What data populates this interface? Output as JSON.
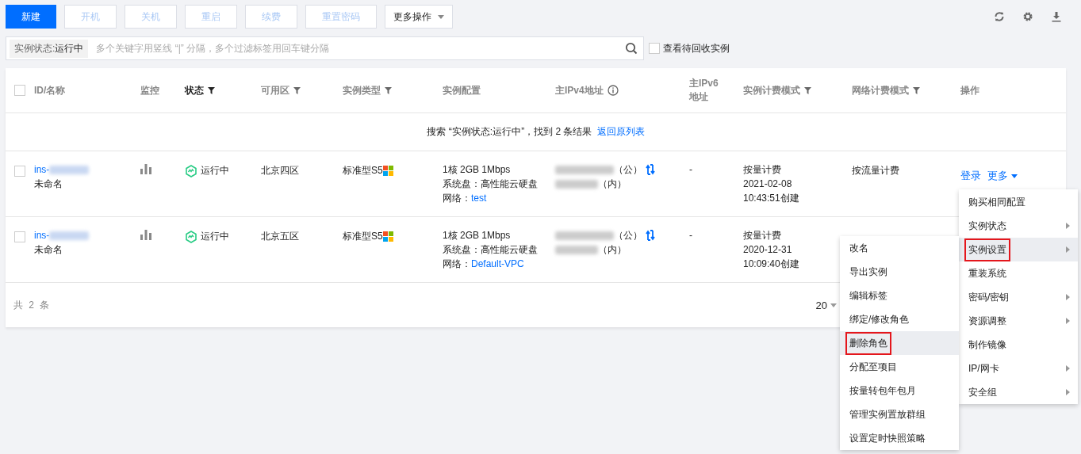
{
  "toolbar": {
    "buttons": [
      {
        "label": "新建",
        "kind": "primary"
      },
      {
        "label": "开机",
        "kind": "disabled"
      },
      {
        "label": "关机",
        "kind": "disabled"
      },
      {
        "label": "重启",
        "kind": "disabled"
      },
      {
        "label": "续费",
        "kind": "disabled"
      },
      {
        "label": "重置密码",
        "kind": "disabled"
      },
      {
        "label": "更多操作",
        "kind": "dropdown"
      }
    ]
  },
  "search": {
    "tag_key": "实例状态:",
    "tag_value": "运行中",
    "placeholder": "多个关键字用竖线 “|” 分隔，多个过滤标签用回车键分隔"
  },
  "recycle_checkbox": {
    "label": "查看待回收实例",
    "checked": false
  },
  "table": {
    "select_all_checked": false,
    "columns": [
      {
        "label": "ID/名称",
        "filter": false,
        "active": false,
        "info": false
      },
      {
        "label": "监控",
        "filter": false,
        "active": false,
        "info": false
      },
      {
        "label": "状态",
        "filter": true,
        "active": true,
        "info": false
      },
      {
        "label": "可用区",
        "filter": true,
        "active": false,
        "info": false
      },
      {
        "label": "实例类型",
        "filter": true,
        "active": false,
        "info": false
      },
      {
        "label": "实例配置",
        "filter": false,
        "active": false,
        "info": false
      },
      {
        "label": "主IPv4地址",
        "filter": false,
        "active": false,
        "info": true
      },
      {
        "label": "主IPv6地址",
        "filter": false,
        "active": false,
        "info": false
      },
      {
        "label": "实例计费模式",
        "filter": true,
        "active": false,
        "info": false
      },
      {
        "label": "网络计费模式",
        "filter": true,
        "active": false,
        "info": false
      },
      {
        "label": "操作",
        "filter": false,
        "active": false,
        "info": false
      }
    ],
    "notice": {
      "text": "搜索 “实例状态:运行中”，找到 2 条结果",
      "link": "返回原列表"
    },
    "rows": [
      {
        "checked": false,
        "id_prefix": "ins-",
        "name": "未命名",
        "status": "运行中",
        "zone": "北京四区",
        "type": "标准型S5",
        "config": "1核 2GB 1Mbps",
        "disk": "系统盘：高性能云硬盘",
        "network_label": "网络：",
        "network": "test",
        "public_ip_suffix": "（公）",
        "private_ip_suffix": "（内）",
        "ipv6": "-",
        "billing": "按量计费",
        "created_date": "2021-02-08",
        "created_time": "10:43:51创建",
        "net_billing": "按流量计费",
        "actions": [
          {
            "label": "登录",
            "dropdown": false
          },
          {
            "label": "更多",
            "dropdown": true
          }
        ]
      },
      {
        "checked": false,
        "id_prefix": "ins-",
        "name": "未命名",
        "status": "运行中",
        "zone": "北京五区",
        "type": "标准型S5",
        "config": "1核 2GB 1Mbps",
        "disk": "系统盘：高性能云硬盘",
        "network_label": "网络：",
        "network": "Default-VPC",
        "public_ip_suffix": "（公）",
        "private_ip_suffix": "（内）",
        "ipv6": "-",
        "billing": "按量计费",
        "created_date": "2020-12-31",
        "created_time": "10:09:40创建"
      }
    ],
    "footer": {
      "total": "共 2 条",
      "page_size": "20"
    }
  },
  "menu": {
    "items": [
      {
        "label": "购买相同配置",
        "submenu": false,
        "selected": false
      },
      {
        "label": "实例状态",
        "submenu": true,
        "selected": false
      },
      {
        "label": "实例设置",
        "submenu": true,
        "selected": true
      },
      {
        "label": "重装系统",
        "submenu": false,
        "selected": false
      },
      {
        "label": "密码/密钥",
        "submenu": true,
        "selected": false
      },
      {
        "label": "资源调整",
        "submenu": true,
        "selected": false
      },
      {
        "label": "制作镜像",
        "submenu": false,
        "selected": false
      },
      {
        "label": "IP/网卡",
        "submenu": true,
        "selected": false
      },
      {
        "label": "安全组",
        "submenu": true,
        "selected": false
      }
    ]
  },
  "submenu": {
    "items": [
      {
        "label": "改名",
        "selected": false
      },
      {
        "label": "导出实例",
        "selected": false
      },
      {
        "label": "编辑标签",
        "selected": false
      },
      {
        "label": "绑定/修改角色",
        "selected": false
      },
      {
        "label": "删除角色",
        "selected": true
      },
      {
        "label": "分配至项目",
        "selected": false
      },
      {
        "label": "按量转包年包月",
        "selected": false
      },
      {
        "label": "管理实例置放群组",
        "selected": false
      },
      {
        "label": "设置定时快照策略",
        "selected": false
      }
    ]
  }
}
